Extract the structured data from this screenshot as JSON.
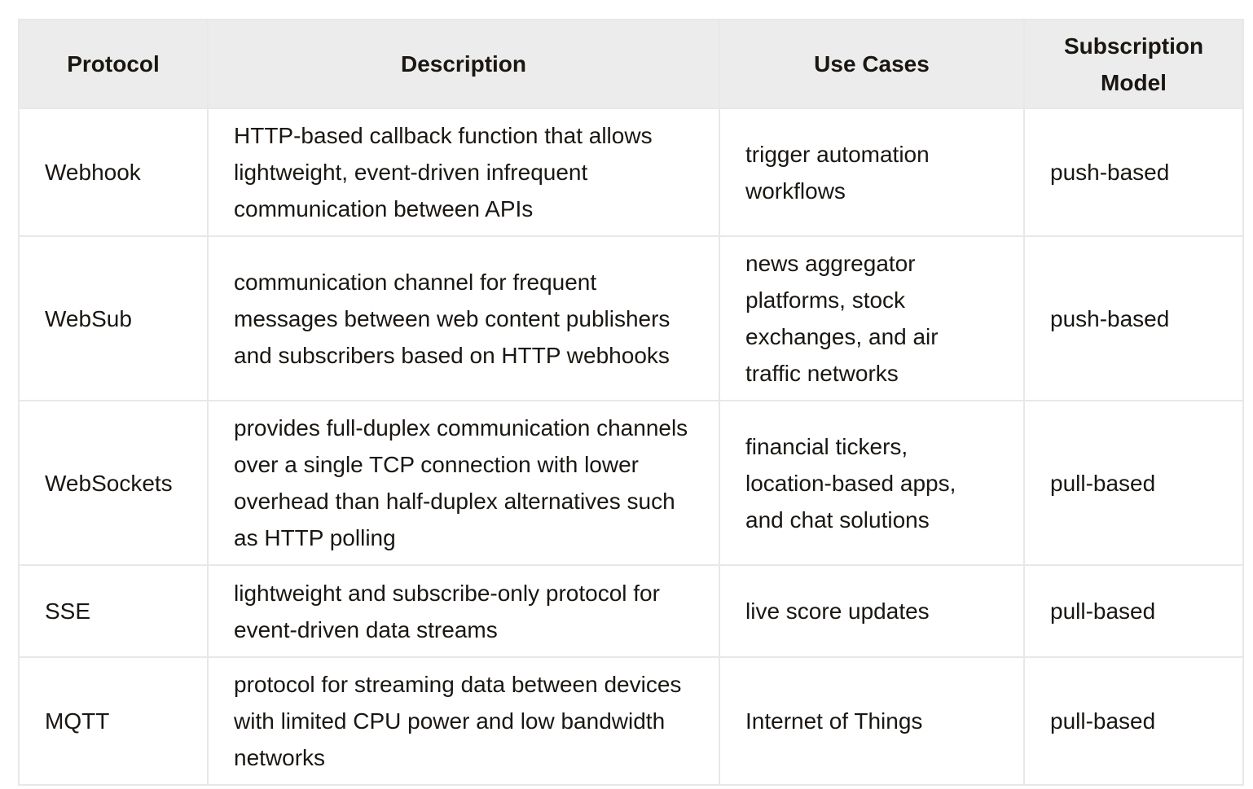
{
  "table": {
    "headers": [
      "Protocol",
      "Description",
      "Use Cases",
      "Subscription Model"
    ],
    "rows": [
      {
        "protocol": "Webhook",
        "description": "HTTP-based callback function that allows lightweight, event-driven infrequent communication between APIs",
        "use_cases": "trigger automation workflows",
        "subscription_model": "push-based"
      },
      {
        "protocol": "WebSub",
        "description": "communication channel for frequent messages between web content publishers and subscribers based on HTTP webhooks",
        "use_cases": "news aggregator platforms, stock exchanges, and air traffic networks",
        "subscription_model": "push-based"
      },
      {
        "protocol": "WebSockets",
        "description": "provides full-duplex communication channels over a single TCP connection with lower overhead than half-duplex alternatives such as HTTP polling",
        "use_cases": "financial tickers, location-based apps, and chat solutions",
        "subscription_model": "pull-based"
      },
      {
        "protocol": "SSE",
        "description": "lightweight and subscribe-only protocol for event-driven data streams",
        "use_cases": "live score updates",
        "subscription_model": "pull-based"
      },
      {
        "protocol": "MQTT",
        "description": "protocol for streaming data between devices with limited CPU power and low bandwidth networks",
        "use_cases": "Internet of Things",
        "subscription_model": "pull-based"
      }
    ]
  },
  "colors": {
    "header_background": "#ececec",
    "border": "#e8e8e8",
    "text": "#1a1612"
  }
}
